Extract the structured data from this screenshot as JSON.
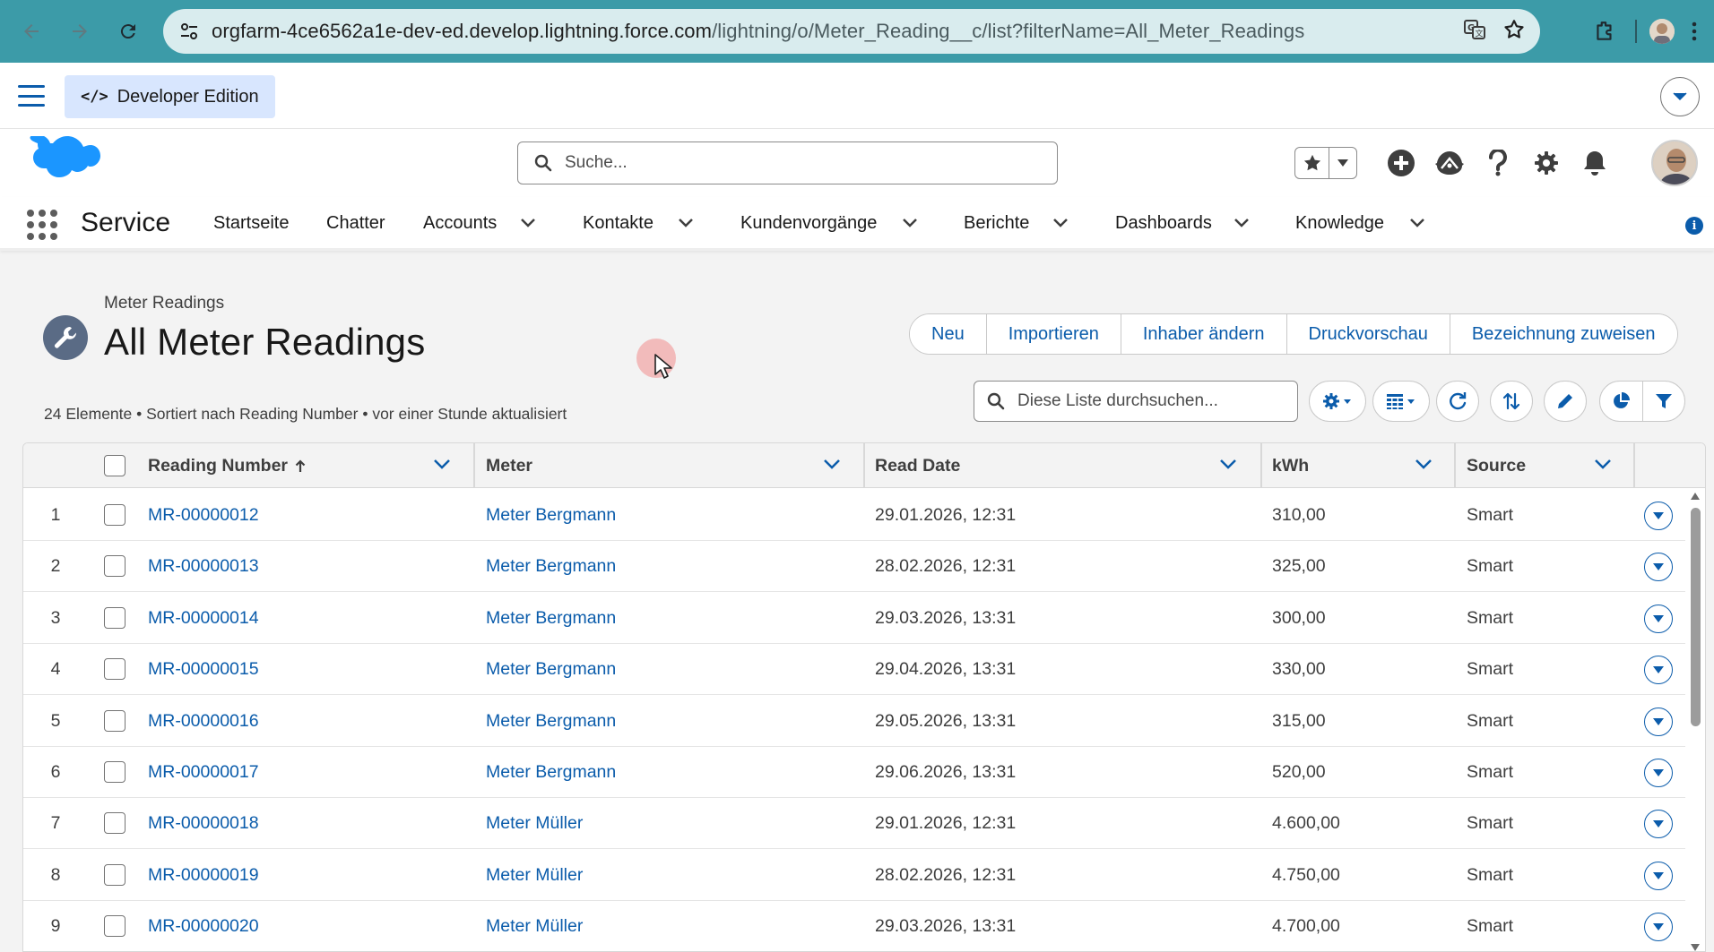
{
  "browser": {
    "url_host": "orgfarm-4ce6562a1e-dev-ed.develop.lightning.force.com",
    "url_path": "/lightning/o/Meter_Reading__c/list?filterName=All_Meter_Readings"
  },
  "devbar": {
    "badge_label": "Developer Edition"
  },
  "global_header": {
    "search_placeholder": "Suche..."
  },
  "app_nav": {
    "app_name": "Service",
    "items": [
      {
        "label": "Startseite"
      },
      {
        "label": "Chatter"
      },
      {
        "label": "Accounts"
      },
      {
        "label": "Kontakte"
      },
      {
        "label": "Kundenvorgänge"
      },
      {
        "label": "Berichte"
      },
      {
        "label": "Dashboards"
      },
      {
        "label": "Knowledge"
      }
    ]
  },
  "page": {
    "breadcrumb": "Meter Readings",
    "title": "All Meter Readings",
    "meta": "24 Elemente • Sortiert nach Reading Number • vor einer Stunde aktualisiert",
    "list_search_placeholder": "Diese Liste durchsuchen...",
    "buttons": {
      "new": "Neu",
      "import": "Importieren",
      "change_owner": "Inhaber ändern",
      "print_preview": "Druckvorschau",
      "assign_label": "Bezeichnung zuweisen"
    }
  },
  "table": {
    "columns": {
      "reading_number": "Reading Number",
      "meter": "Meter",
      "read_date": "Read Date",
      "kwh": "kWh",
      "source": "Source"
    },
    "rows": [
      {
        "n": "1",
        "reading": "MR-00000012",
        "meter": "Meter Bergmann",
        "date": "29.01.2026, 12:31",
        "kwh": "310,00",
        "source": "Smart"
      },
      {
        "n": "2",
        "reading": "MR-00000013",
        "meter": "Meter Bergmann",
        "date": "28.02.2026, 12:31",
        "kwh": "325,00",
        "source": "Smart"
      },
      {
        "n": "3",
        "reading": "MR-00000014",
        "meter": "Meter Bergmann",
        "date": "29.03.2026, 13:31",
        "kwh": "300,00",
        "source": "Smart"
      },
      {
        "n": "4",
        "reading": "MR-00000015",
        "meter": "Meter Bergmann",
        "date": "29.04.2026, 13:31",
        "kwh": "330,00",
        "source": "Smart"
      },
      {
        "n": "5",
        "reading": "MR-00000016",
        "meter": "Meter Bergmann",
        "date": "29.05.2026, 13:31",
        "kwh": "315,00",
        "source": "Smart"
      },
      {
        "n": "6",
        "reading": "MR-00000017",
        "meter": "Meter Bergmann",
        "date": "29.06.2026, 13:31",
        "kwh": "520,00",
        "source": "Smart"
      },
      {
        "n": "7",
        "reading": "MR-00000018",
        "meter": "Meter Müller",
        "date": "29.01.2026, 12:31",
        "kwh": "4.600,00",
        "source": "Smart"
      },
      {
        "n": "8",
        "reading": "MR-00000019",
        "meter": "Meter Müller",
        "date": "28.02.2026, 12:31",
        "kwh": "4.750,00",
        "source": "Smart"
      },
      {
        "n": "9",
        "reading": "MR-00000020",
        "meter": "Meter Müller",
        "date": "29.03.2026, 13:31",
        "kwh": "4.700,00",
        "source": "Smart"
      }
    ]
  },
  "colors": {
    "chrome": "#3c9ba8",
    "link": "#0b5cab",
    "sf_cloud": "#1b96ff"
  }
}
